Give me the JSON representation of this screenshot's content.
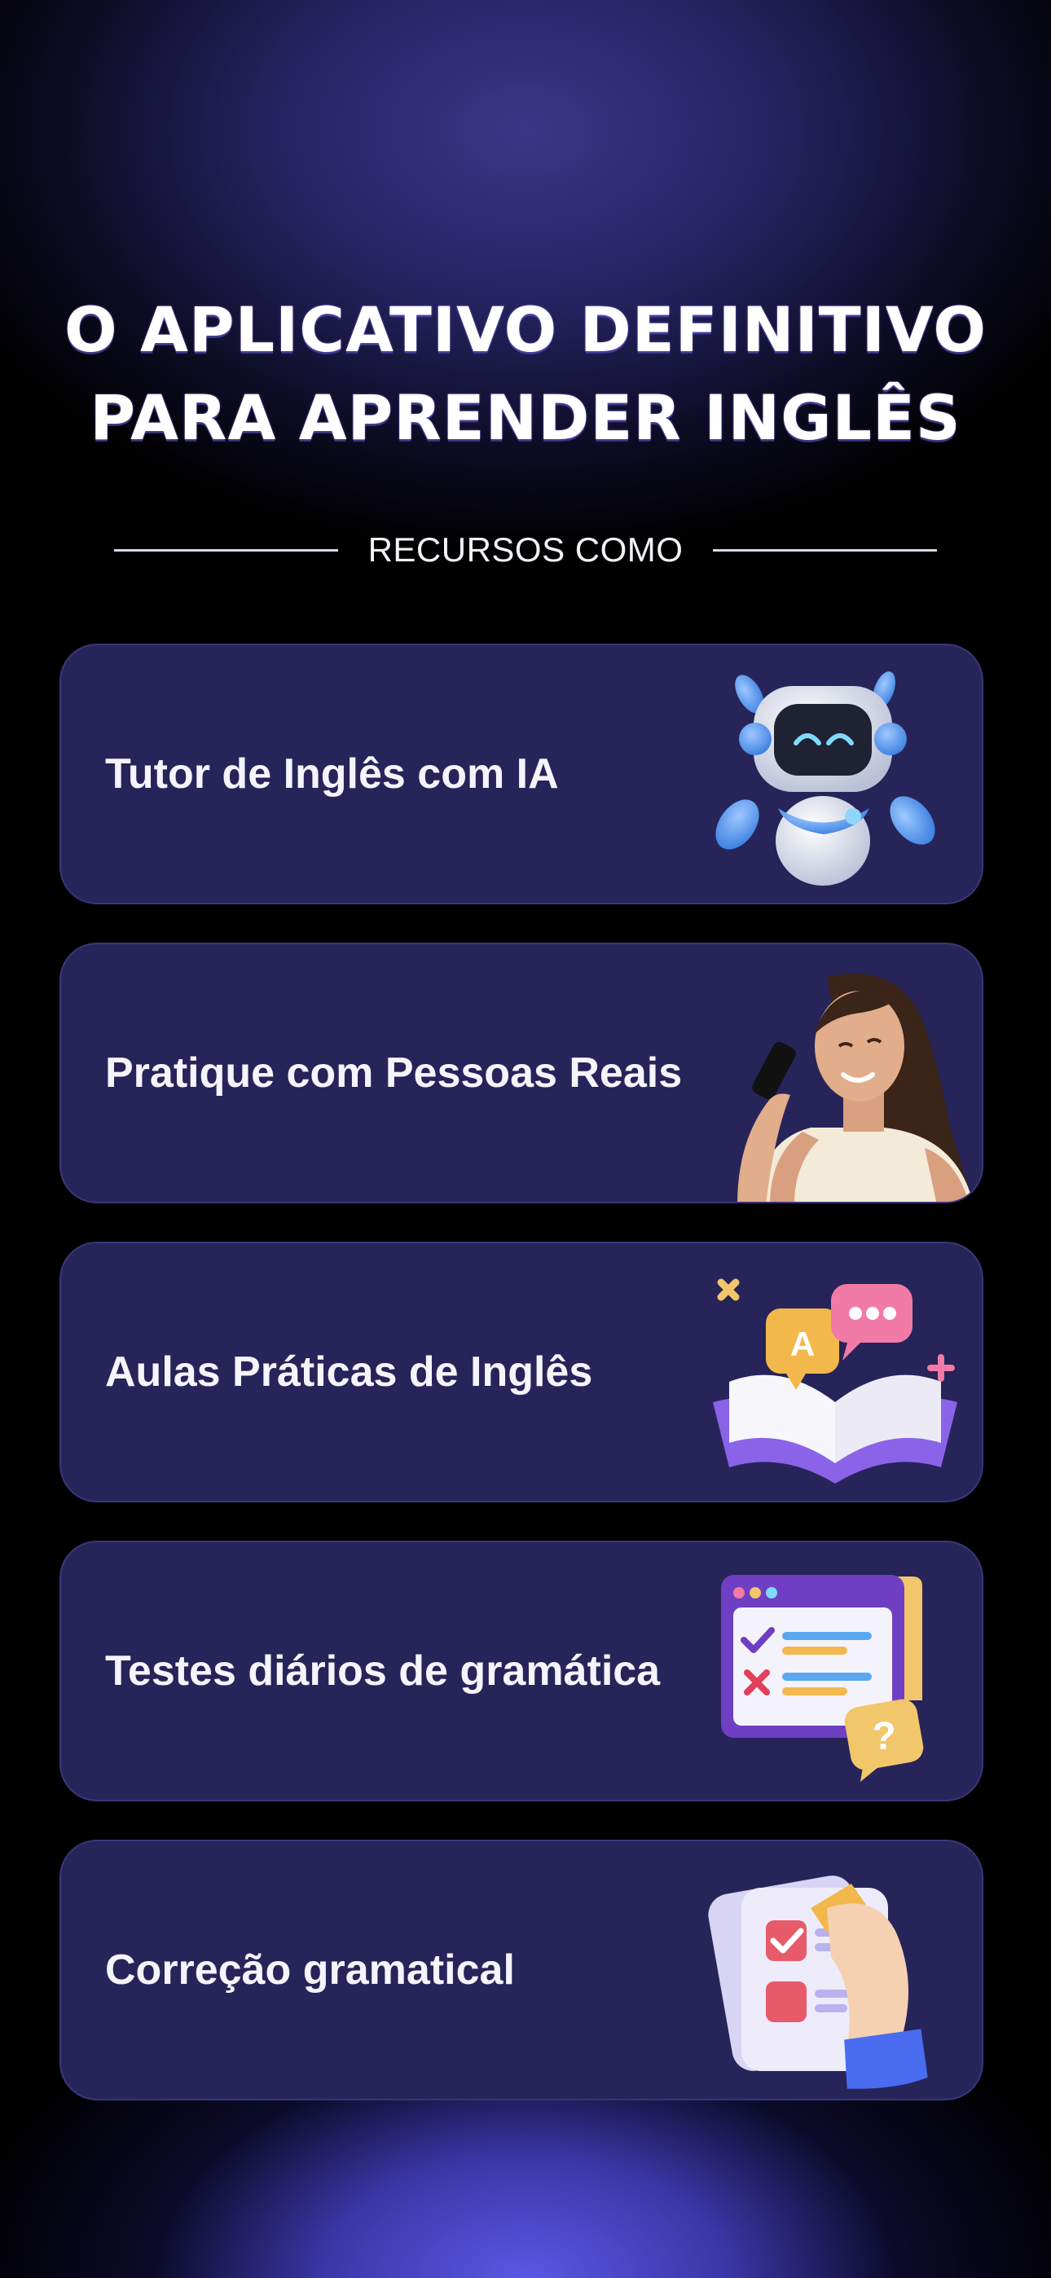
{
  "headline": {
    "line1": "O APLICATIVO DEFINITIVO",
    "line2": "PARA APRENDER INGLÊS"
  },
  "section_label": "RECURSOS COMO",
  "features": [
    {
      "title": "Tutor de Inglês com IA",
      "icon": "robot-icon"
    },
    {
      "title": "Pratique com Pessoas Reais",
      "icon": "woman-on-phone-photo"
    },
    {
      "title": "Aulas Práticas de Inglês",
      "icon": "open-book-chat-icon"
    },
    {
      "title": "Testes diários de gramática",
      "icon": "quiz-window-icon"
    },
    {
      "title": "Correção gramatical",
      "icon": "checklist-hand-icon"
    }
  ],
  "illustration_glyphs": {
    "book_letter": "A",
    "help_mark": "?"
  },
  "colors": {
    "card_bg": "#27245a",
    "accent_purple": "#8a63e8",
    "accent_yellow": "#f2b84b",
    "accent_pink": "#f27aa6"
  }
}
